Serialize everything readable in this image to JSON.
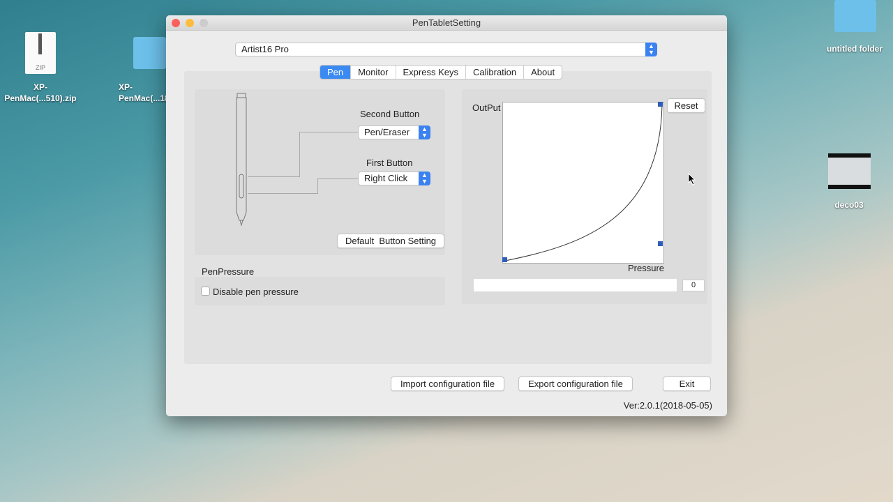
{
  "desktop": {
    "icons": [
      {
        "label": "XP-\nPenMac(...510).zip",
        "badge": "ZIP"
      },
      {
        "label": "XP-\nPenMac(...18"
      },
      {
        "label": "untitled folder"
      },
      {
        "label": "deco03"
      }
    ]
  },
  "window": {
    "title": "PenTabletSetting",
    "device": "Artist16 Pro",
    "tabs": [
      {
        "label": "Pen",
        "active": true
      },
      {
        "label": "Monitor"
      },
      {
        "label": "Express Keys"
      },
      {
        "label": "Calibration"
      },
      {
        "label": "About"
      }
    ],
    "pen": {
      "second_button_label": "Second Button",
      "second_button_value": "Pen/Eraser",
      "first_button_label": "First Button",
      "first_button_value": "Right Click",
      "default_button": "Default  Button Setting"
    },
    "pressure": {
      "section_label": "PenPressure",
      "disable_label": "Disable pen pressure",
      "disable_checked": false,
      "output_label": "OutPut",
      "pressure_label": "Pressure",
      "reset": "Reset",
      "value": "0",
      "level_fraction": 0
    },
    "import": "Import configuration file",
    "export": "Export configuration file",
    "exit": "Exit",
    "version": "Ver:2.0.1(2018-05-05)",
    "accent": "#3b8af2"
  }
}
